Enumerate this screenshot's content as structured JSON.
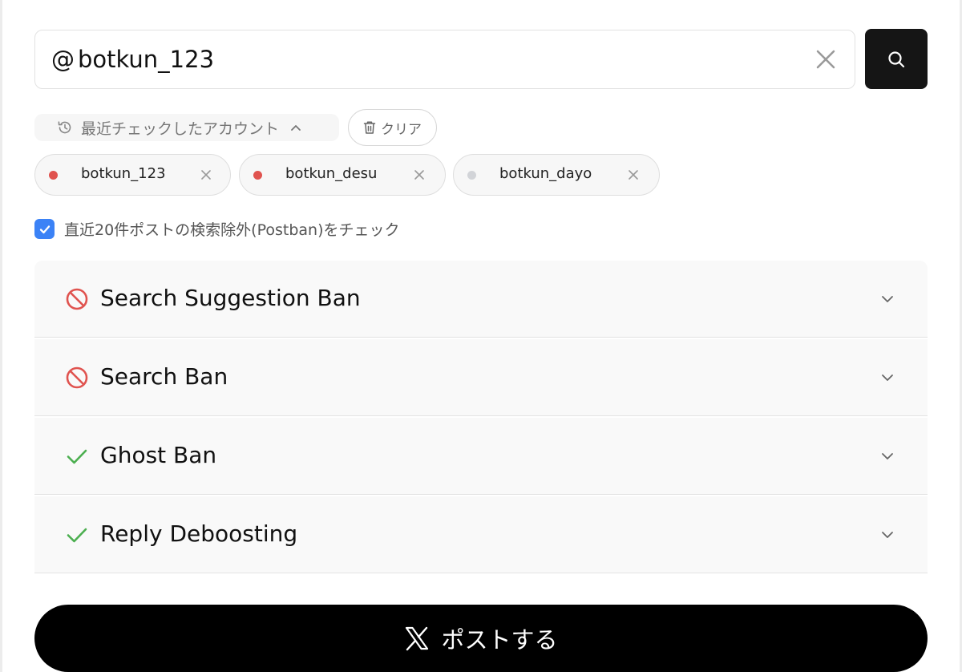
{
  "search": {
    "at_symbol": "@",
    "value": "botkun_123"
  },
  "recent": {
    "label": "最近チェックしたアカウント",
    "clear_label": "クリア",
    "accounts": [
      {
        "name": "botkun_123",
        "status_color": "#e0534f"
      },
      {
        "name": "botkun_desu",
        "status_color": "#e0534f"
      },
      {
        "name": "botkun_dayo",
        "status_color": "#d2d4d8"
      }
    ]
  },
  "postban_check": {
    "label": "直近20件ポストの検索除外(Postban)をチェック",
    "checked": true
  },
  "results": [
    {
      "title": "Search Suggestion Ban",
      "status": "banned"
    },
    {
      "title": "Search Ban",
      "status": "banned"
    },
    {
      "title": "Ghost Ban",
      "status": "ok"
    },
    {
      "title": "Reply Deboosting",
      "status": "ok"
    }
  ],
  "post_button": {
    "label": "ポストする"
  },
  "colors": {
    "banned": "#e0534f",
    "ok": "#4caf50",
    "accent": "#3b82f6",
    "dark": "#151515"
  }
}
